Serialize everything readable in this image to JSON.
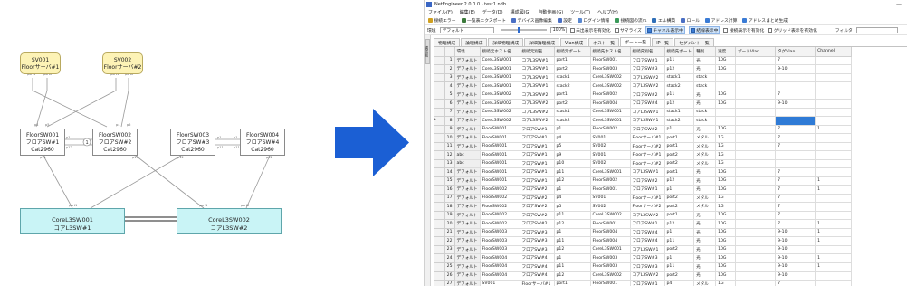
{
  "diagram": {
    "servers": [
      {
        "name": "SV001",
        "label": "Floorサーバ#1"
      },
      {
        "name": "SV002",
        "label": "Floorサーバ#2"
      }
    ],
    "floor_switches": [
      {
        "name": "FloorSW001",
        "label": "フロアSW#1",
        "model": "Cat2960"
      },
      {
        "name": "FloorSW002",
        "label": "フロアSW#2",
        "model": "Cat2960"
      },
      {
        "name": "FloorSW003",
        "label": "フロアSW#3",
        "model": "Cat2960"
      },
      {
        "name": "FloorSW004",
        "label": "フロアSW#4",
        "model": "Cat2960"
      }
    ],
    "core_switches": [
      {
        "name": "CoreL3SW001",
        "label": "コアL3SW#1"
      },
      {
        "name": "CoreL3SW002",
        "label": "コアL3SW#2"
      }
    ],
    "badges": [
      "1",
      "1"
    ],
    "port_labels": {
      "sv1_p1": "port1",
      "sv1_p2": "port2",
      "sv2_p1": "port1",
      "sv2_p2": "port2",
      "fl1_p4": "p4",
      "fl1_p5": "p5",
      "fl1_p1": "p1",
      "fl1_p11": "p11",
      "fl1_p12": "p12",
      "fl2_p4": "p4",
      "fl2_p5": "p5",
      "fl2_p1": "p1",
      "fl2_p11": "p11",
      "fl2_p12": "p12",
      "fl3_p1": "p1",
      "fl3_p11": "p11",
      "fl3_p12": "p12",
      "fl4_p1": "p1",
      "fl4_p11": "p11",
      "fl4_p12": "p12",
      "core1_port1": "port1",
      "core2_port1": "port1",
      "core2_port2": "port2"
    }
  },
  "app": {
    "title": "NetEngineer 2.0.0.0 - test1.ndb",
    "window_controls": "—",
    "menu": [
      "ファイル(F)",
      "編集(E)",
      "データ(D)",
      "構成図(G)",
      "自動作画(G)",
      "ツール(T)",
      "ヘルプ(H)"
    ],
    "toolbar1": [
      {
        "label": "接続エラー",
        "icon": "warning-icon",
        "color": "#d0a020"
      },
      {
        "label": "一覧表エクスポート",
        "icon": "export-icon",
        "color": "#3b7a3b"
      },
      {
        "label": "デバイス画像編集",
        "icon": "image-edit-icon",
        "color": "#4a6fc4"
      },
      {
        "label": "設定",
        "icon": "gear-icon",
        "color": "#4a6fc4"
      },
      {
        "label": "ログイン情報",
        "icon": "login-icon",
        "color": "#5a88d0"
      },
      {
        "label": "接続図の流れ",
        "icon": "flow-icon",
        "color": "#3b9a5a"
      },
      {
        "label": "エル構築",
        "icon": "build-icon",
        "color": "#2f6fb8"
      },
      {
        "label": "ロール",
        "icon": "role-icon",
        "color": "#4a6fc4"
      },
      {
        "label": "アドレス計算",
        "icon": "calc-icon",
        "color": "#3a7bd5"
      },
      {
        "label": "アドレスまとめ生成",
        "icon": "address-icon",
        "color": "#3a7bd5"
      }
    ],
    "toolbar2": {
      "env_label": "環境",
      "env_value": "デフォルト",
      "zoom": "100%",
      "checks": [
        {
          "label": "未出表示を有効化",
          "checked": false,
          "hl": false
        },
        {
          "label": "サマライズ",
          "checked": false,
          "hl": false
        },
        {
          "label": "チャネル表示中",
          "checked": true,
          "hl": true
        },
        {
          "label": "結線表示中",
          "checked": true,
          "hl": true
        },
        {
          "label": "接続表示を有効化",
          "checked": false,
          "hl": false
        },
        {
          "label": "グリッド表示を有効化",
          "checked": false,
          "hl": false
        }
      ],
      "filter_label": "フィルタ"
    },
    "vertical_tab": "構成図",
    "tabs": [
      "物理構成",
      "論理構成",
      "詳細物理構成",
      "詳細論理構成",
      "Vlan構成",
      "ホスト一覧",
      "ポート一覧",
      "IP一覧",
      "セグメント一覧"
    ],
    "active_tab": 6,
    "columns": [
      "環境",
      "接続元ホスト名",
      "接続元別名",
      "接続元ポート",
      "接続先ホスト名",
      "接続先別名",
      "接続先ポート",
      "種別",
      "速度",
      "ポートVlan",
      "タグVlan",
      "Channel"
    ],
    "rows": [
      [
        "1",
        "デフォルト",
        "CoreL3SW001",
        "コアL3SW#1",
        "port1",
        "FloorSW001",
        "フロアSW#1",
        "p11",
        "光",
        "10G",
        "",
        "7",
        ""
      ],
      [
        "2",
        "デフォルト",
        "CoreL3SW001",
        "コアL3SW#1",
        "port2",
        "FloorSW003",
        "フロアSW#3",
        "p12",
        "光",
        "10G",
        "",
        "9-10",
        ""
      ],
      [
        "3",
        "デフォルト",
        "CoreL3SW001",
        "コアL3SW#1",
        "stack1",
        "CoreL3SW002",
        "コアL3SW#2",
        "stack1",
        "stack",
        "",
        "",
        "",
        ""
      ],
      [
        "4",
        "デフォルト",
        "CoreL3SW001",
        "コアL3SW#1",
        "stack2",
        "CoreL3SW002",
        "コアL3SW#2",
        "stack2",
        "stack",
        "",
        "",
        "",
        ""
      ],
      [
        "5",
        "デフォルト",
        "CoreL3SW002",
        "コアL3SW#2",
        "port1",
        "FloorSW002",
        "フロアSW#2",
        "p11",
        "光",
        "10G",
        "",
        "7",
        ""
      ],
      [
        "6",
        "デフォルト",
        "CoreL3SW002",
        "コアL3SW#2",
        "port2",
        "FloorSW004",
        "フロアSW#4",
        "p12",
        "光",
        "10G",
        "",
        "9-10",
        ""
      ],
      [
        "7",
        "デフォルト",
        "CoreL3SW002",
        "コアL3SW#2",
        "stack1",
        "CoreL3SW001",
        "コアL3SW#1",
        "stack1",
        "stack",
        "",
        "",
        "",
        ""
      ],
      [
        "8",
        "デフォルト",
        "CoreL3SW002",
        "コアL3SW#2",
        "stack2",
        "CoreL3SW001",
        "コアL3SW#1",
        "stack2",
        "stack",
        "",
        "",
        "",
        ""
      ],
      [
        "9",
        "デフォルト",
        "FloorSW001",
        "フロアSW#1",
        "p1",
        "FloorSW002",
        "フロアSW#2",
        "p1",
        "光",
        "10G",
        "",
        "7",
        "1"
      ],
      [
        "10",
        "デフォルト",
        "FloorSW001",
        "フロアSW#1",
        "p4",
        "SV001",
        "Floorサーバ#1",
        "port1",
        "メタル",
        "1G",
        "",
        "7",
        ""
      ],
      [
        "11",
        "デフォルト",
        "FloorSW001",
        "フロアSW#1",
        "p5",
        "SV002",
        "Floorサーバ#2",
        "port1",
        "メタル",
        "1G",
        "",
        "7",
        ""
      ],
      [
        "12",
        "abc",
        "FloorSW001",
        "フロアSW#1",
        "p9",
        "SV001",
        "Floorサーバ#1",
        "port2",
        "メタル",
        "1G",
        "",
        "",
        ""
      ],
      [
        "13",
        "abc",
        "FloorSW001",
        "フロアSW#1",
        "p10",
        "SV002",
        "Floorサーバ#2",
        "port2",
        "メタル",
        "1G",
        "",
        "",
        ""
      ],
      [
        "14",
        "デフォルト",
        "FloorSW001",
        "フロアSW#1",
        "p11",
        "CoreL3SW001",
        "コアL3SW#1",
        "port1",
        "光",
        "10G",
        "",
        "7",
        ""
      ],
      [
        "15",
        "デフォルト",
        "FloorSW001",
        "フロアSW#1",
        "p12",
        "FloorSW002",
        "フロアSW#2",
        "p12",
        "光",
        "10G",
        "",
        "7",
        "1"
      ],
      [
        "16",
        "デフォルト",
        "FloorSW002",
        "フロアSW#2",
        "p1",
        "FloorSW001",
        "フロアSW#1",
        "p1",
        "光",
        "10G",
        "",
        "7",
        "1"
      ],
      [
        "17",
        "デフォルト",
        "FloorSW002",
        "フロアSW#2",
        "p4",
        "SV001",
        "Floorサーバ#1",
        "port2",
        "メタル",
        "1G",
        "",
        "7",
        ""
      ],
      [
        "18",
        "デフォルト",
        "FloorSW002",
        "フロアSW#2",
        "p5",
        "SV002",
        "Floorサーバ#2",
        "port2",
        "メタル",
        "1G",
        "",
        "7",
        ""
      ],
      [
        "19",
        "デフォルト",
        "FloorSW002",
        "フロアSW#2",
        "p11",
        "CoreL3SW002",
        "コアL3SW#2",
        "port1",
        "光",
        "10G",
        "",
        "7",
        ""
      ],
      [
        "20",
        "デフォルト",
        "FloorSW002",
        "フロアSW#2",
        "p12",
        "FloorSW001",
        "フロアSW#1",
        "p12",
        "光",
        "10G",
        "",
        "7",
        "1"
      ],
      [
        "21",
        "デフォルト",
        "FloorSW003",
        "フロアSW#3",
        "p1",
        "FloorSW004",
        "フロアSW#4",
        "p1",
        "光",
        "10G",
        "",
        "9-10",
        "1"
      ],
      [
        "22",
        "デフォルト",
        "FloorSW003",
        "フロアSW#3",
        "p11",
        "FloorSW004",
        "フロアSW#4",
        "p11",
        "光",
        "10G",
        "",
        "9-10",
        "1"
      ],
      [
        "23",
        "デフォルト",
        "FloorSW003",
        "フロアSW#3",
        "p12",
        "CoreL3SW001",
        "コアL3SW#1",
        "port2",
        "光",
        "10G",
        "",
        "9-10",
        ""
      ],
      [
        "24",
        "デフォルト",
        "FloorSW004",
        "フロアSW#4",
        "p1",
        "FloorSW003",
        "フロアSW#3",
        "p1",
        "光",
        "10G",
        "",
        "9-10",
        "1"
      ],
      [
        "25",
        "デフォルト",
        "FloorSW004",
        "フロアSW#4",
        "p11",
        "FloorSW003",
        "フロアSW#3",
        "p11",
        "光",
        "10G",
        "",
        "9-10",
        "1"
      ],
      [
        "26",
        "デフォルト",
        "FloorSW004",
        "フロアSW#4",
        "p12",
        "CoreL3SW002",
        "コアL3SW#2",
        "port2",
        "光",
        "10G",
        "",
        "9-10",
        ""
      ],
      [
        "27",
        "デフォルト",
        "SV001",
        "Floorサーバ#1",
        "port1",
        "FloorSW001",
        "フロアSW#1",
        "p4",
        "メタル",
        "1G",
        "",
        "7",
        ""
      ]
    ],
    "current_row": "8",
    "selected_cell_column": "タグVlan",
    "colors": {
      "accent": "#2f7bd6",
      "core_fill": "#c9f4f6",
      "server_fill": "#fdf3b6",
      "arrow": "#1b5fd4"
    }
  }
}
